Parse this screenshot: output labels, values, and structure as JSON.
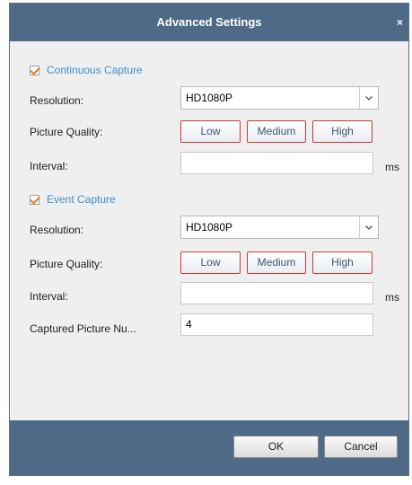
{
  "dialog": {
    "title": "Advanced Settings",
    "close_glyph": "×"
  },
  "continuous": {
    "label": "Continuous Capture",
    "checked": true,
    "resolution_label": "Resolution:",
    "resolution_value": "HD1080P",
    "quality_label": "Picture Quality:",
    "quality_buttons": [
      "Low",
      "Medium",
      "High"
    ],
    "interval_label": "Interval:",
    "interval_value": "",
    "interval_unit": "ms"
  },
  "event": {
    "label": "Event Capture",
    "checked": true,
    "resolution_label": "Resolution:",
    "resolution_value": "HD1080P",
    "quality_label": "Picture Quality:",
    "quality_buttons": [
      "Low",
      "Medium",
      "High"
    ],
    "interval_label": "Interval:",
    "interval_value": "",
    "interval_unit": "ms",
    "captured_label": "Captured Picture Nu...",
    "captured_value": "4"
  },
  "footer": {
    "ok_label": "OK",
    "cancel_label": "Cancel"
  },
  "colors": {
    "title_bar": "#4e6a87",
    "section_label": "#3d8fd1",
    "checkmark": "#e07b14",
    "quality_border": "#c93a3a"
  }
}
